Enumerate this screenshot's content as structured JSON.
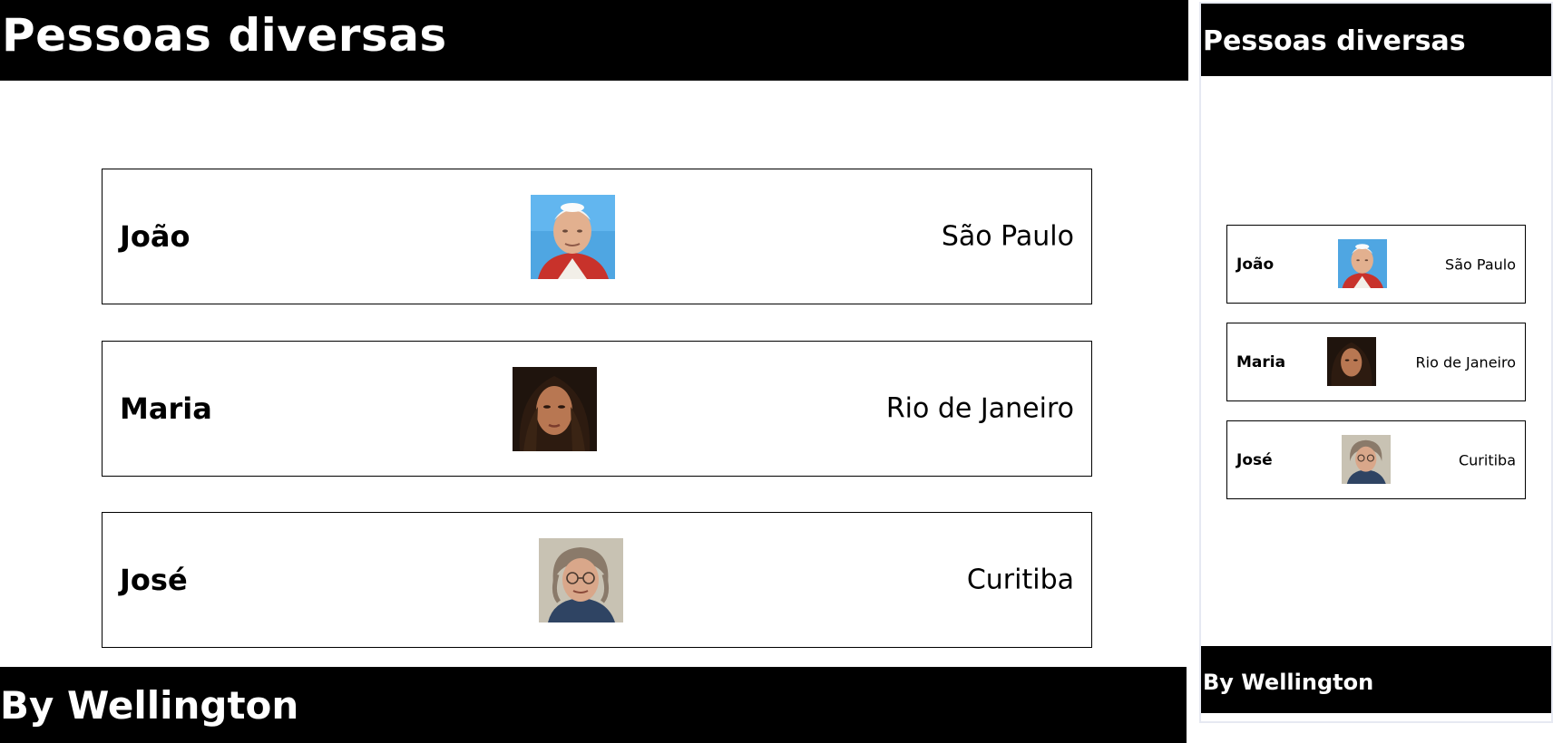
{
  "header": {
    "title": "Pessoas diversas"
  },
  "people": [
    {
      "name": "João",
      "city": "São Paulo",
      "photo": "elderly-man-portrait"
    },
    {
      "name": "Maria",
      "city": "Rio de Janeiro",
      "photo": "woman-portrait"
    },
    {
      "name": "José",
      "city": "Curitiba",
      "photo": "man-with-glasses-portrait"
    }
  ],
  "footer": {
    "text": "By Wellington"
  },
  "colors": {
    "bar": "#000000",
    "bar_text": "#ffffff",
    "card_border": "#000000"
  }
}
